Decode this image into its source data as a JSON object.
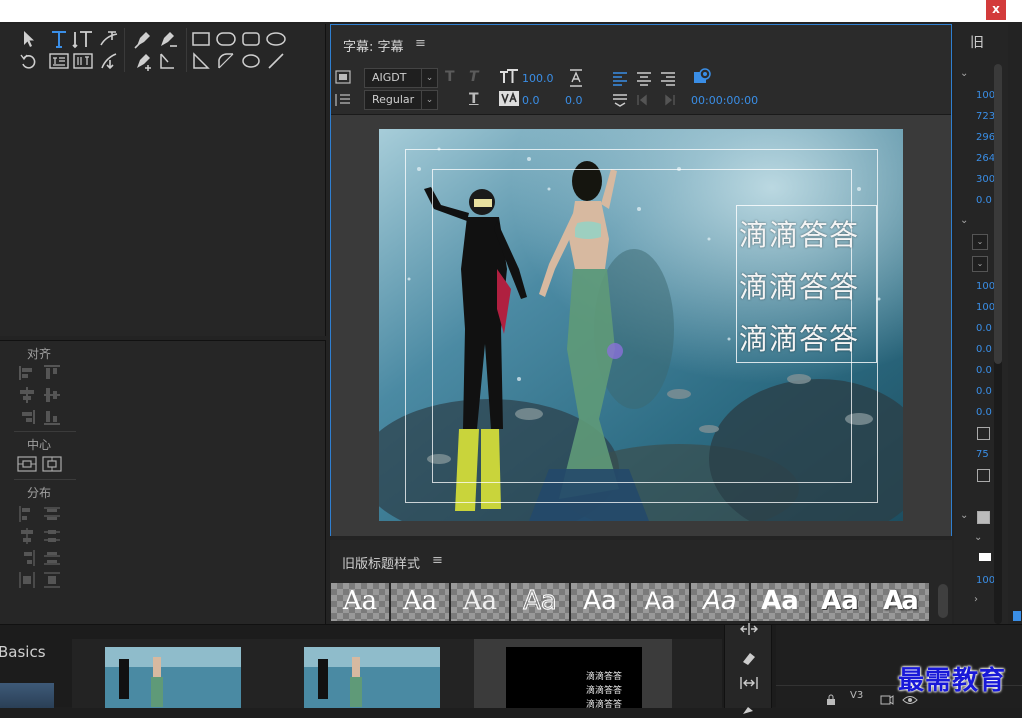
{
  "window": {
    "close_label": "x"
  },
  "align_panel": {
    "align_label": "对齐",
    "center_label": "中心",
    "distribute_label": "分布"
  },
  "title_panel": {
    "tab": "字幕: 字幕",
    "menu_glyph": "≡",
    "font_family": "AIGDT",
    "font_style": "Regular",
    "font_size": "100.0",
    "kerning": "0.0",
    "leading": "0.0",
    "timecode": "00:00:00:00",
    "captions": [
      "滴滴答答",
      "滴滴答答",
      "滴滴答答"
    ]
  },
  "styles_panel": {
    "title": "旧版标题样式",
    "menu_glyph": "≡",
    "swatch_label": "Aa"
  },
  "properties": {
    "tab": "旧",
    "values": [
      "100",
      "723",
      "296",
      "264",
      "300",
      "0.0",
      "100",
      "100",
      "0.0",
      "0.0",
      "0.0",
      "0.0",
      "0.0",
      "75",
      "100"
    ]
  },
  "project": {
    "workspace_label": "Basics",
    "thumb3_lines": [
      "滴滴答答",
      "滴滴答答",
      "滴滴答答"
    ]
  },
  "timeline": {
    "track_label": "V3"
  },
  "watermark": "最需教育",
  "colors": {
    "accent": "#3a8ee6",
    "panel_focus": "#2f7fd0",
    "close": "#d33b3b",
    "watermark": "#1818d8"
  }
}
